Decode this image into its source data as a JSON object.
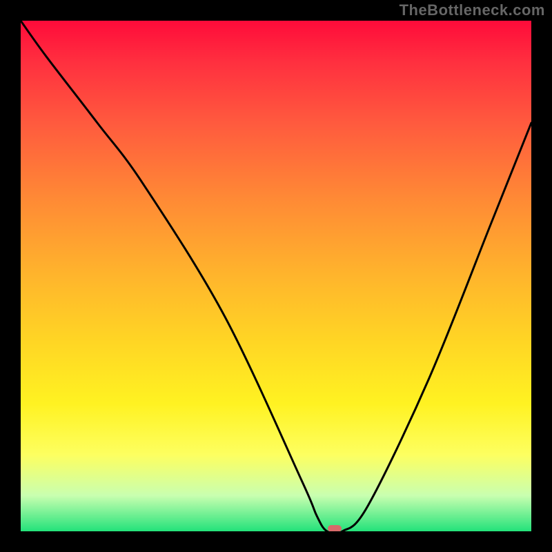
{
  "watermark": "TheBottleneck.com",
  "chart_data": {
    "type": "line",
    "title": "",
    "xlabel": "",
    "ylabel": "",
    "xlim": [
      0,
      100
    ],
    "ylim": [
      0,
      100
    ],
    "grid": false,
    "legend": false,
    "background": "rainbow-vertical-gradient",
    "series": [
      {
        "name": "bottleneck-curve",
        "color": "#000000",
        "x": [
          0,
          5,
          15,
          24,
          40,
          55,
          58,
          60,
          63,
          68,
          80,
          92,
          100
        ],
        "y": [
          100,
          93,
          80,
          68,
          42,
          10,
          3,
          0,
          0,
          5,
          30,
          60,
          80
        ]
      }
    ],
    "marker": {
      "x": 61.5,
      "y": 0,
      "color": "#d86a6a"
    }
  }
}
